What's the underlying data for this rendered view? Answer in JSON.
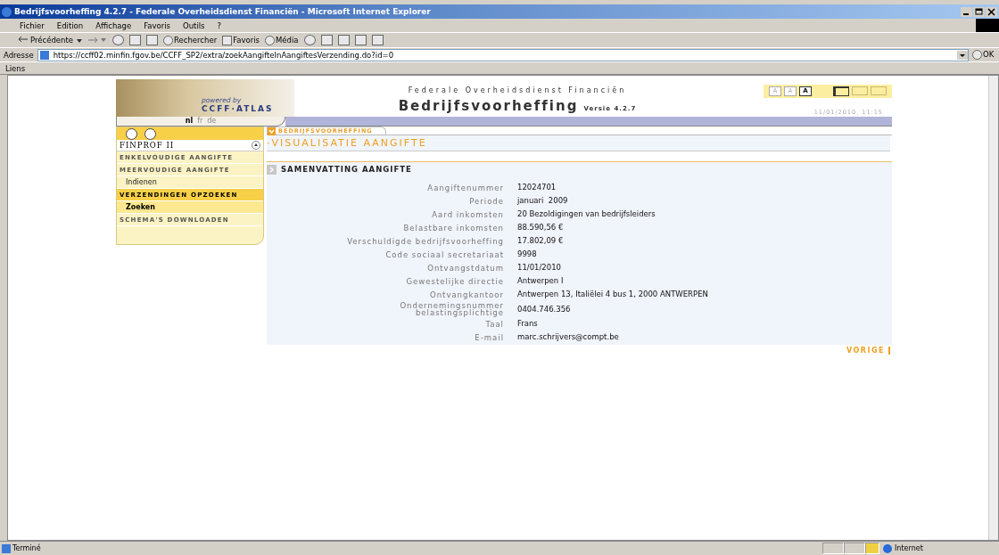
{
  "window": {
    "title": "Bedrijfsvoorheffing 4.2.7 - Federale Overheidsdienst Financiën - Microsoft Internet Explorer"
  },
  "menu": [
    "Fichier",
    "Edition",
    "Affichage",
    "Favoris",
    "Outils",
    "?"
  ],
  "toolbar": {
    "back": "Précédente",
    "search": "Rechercher",
    "favorites": "Favoris",
    "media": "Média"
  },
  "address": {
    "label": "Adresse",
    "url": "https://ccff02.minfin.fgov.be/CCFF_SP2/extra/zoekAangifteInAangiftesVerzending.do?id=0",
    "go": "OK"
  },
  "links_bar": "Liens",
  "header": {
    "powered_by": "powered by",
    "brand": "CCFF·ATLAS",
    "agency": "Federale Overheidsdienst Financiën",
    "app_title": "Bedrijfsvoorheffing",
    "version": "Versie 4.2.7",
    "datetime": "11/01/2010, 11:15",
    "languages": [
      {
        "label": "nl",
        "selected": true
      },
      {
        "label": "fr",
        "selected": false
      },
      {
        "label": "de",
        "selected": false
      }
    ],
    "font_sizes": [
      {
        "label": "A",
        "selected": false
      },
      {
        "label": "A",
        "selected": false
      },
      {
        "label": "A",
        "selected": true
      }
    ],
    "layouts": [
      {
        "selected": true
      },
      {
        "selected": false
      },
      {
        "selected": false
      }
    ]
  },
  "sidebar": {
    "title": "FINPROF II",
    "items": [
      {
        "kind": "section",
        "label": "ENKELVOUDIGE AANGIFTE",
        "selected": false
      },
      {
        "kind": "section",
        "label": "MEERVOUDIGE AANGIFTE",
        "selected": false
      },
      {
        "kind": "sub",
        "label": "Indienen",
        "selected": false
      },
      {
        "kind": "section",
        "label": "VERZENDINGEN OPZOEKEN",
        "selected": true
      },
      {
        "kind": "sub",
        "label": "Zoeken",
        "selected": true
      },
      {
        "kind": "section",
        "label": "SCHEMA'S DOWNLOADEN",
        "selected": false
      }
    ]
  },
  "main": {
    "tab": "BEDRIJFSVOORHEFFING",
    "page_title": "·VISUALISATIE AANGIFTE",
    "section": "SAMENVATTING AANGIFTE",
    "fields": [
      {
        "label": "Aangiftenummer",
        "value": "12024701"
      },
      {
        "label": "Periode",
        "value": "januari  2009"
      },
      {
        "label": "Aard inkomsten",
        "value": "20 Bezoldigingen van bedrijfsleiders"
      },
      {
        "label": "Belastbare inkomsten",
        "value": "88.590,56 €"
      },
      {
        "label": "Verschuldigde bedrijfsvoorheffing",
        "value": "17.802,09 €"
      },
      {
        "label": "Code sociaal secretariaat",
        "value": "9998"
      },
      {
        "label": "Ontvangstdatum",
        "value": "11/01/2010"
      },
      {
        "label": "Gewestelijke directie",
        "value": "Antwerpen I"
      },
      {
        "label": "Ontvangkantoor",
        "value": "Antwerpen 13, Italiëlei 4 bus 1, 2000 ANTWERPEN"
      },
      {
        "label": "Ondernemingsnummer\nbelastingsplichtige",
        "value": "0404.746.356"
      },
      {
        "label": "Taal",
        "value": "Frans"
      },
      {
        "label": "E-mail",
        "value": "marc.schrijvers@compt.be"
      }
    ],
    "back_button": "VORIGE"
  },
  "status": {
    "text": "Terminé",
    "zone": "Internet"
  }
}
